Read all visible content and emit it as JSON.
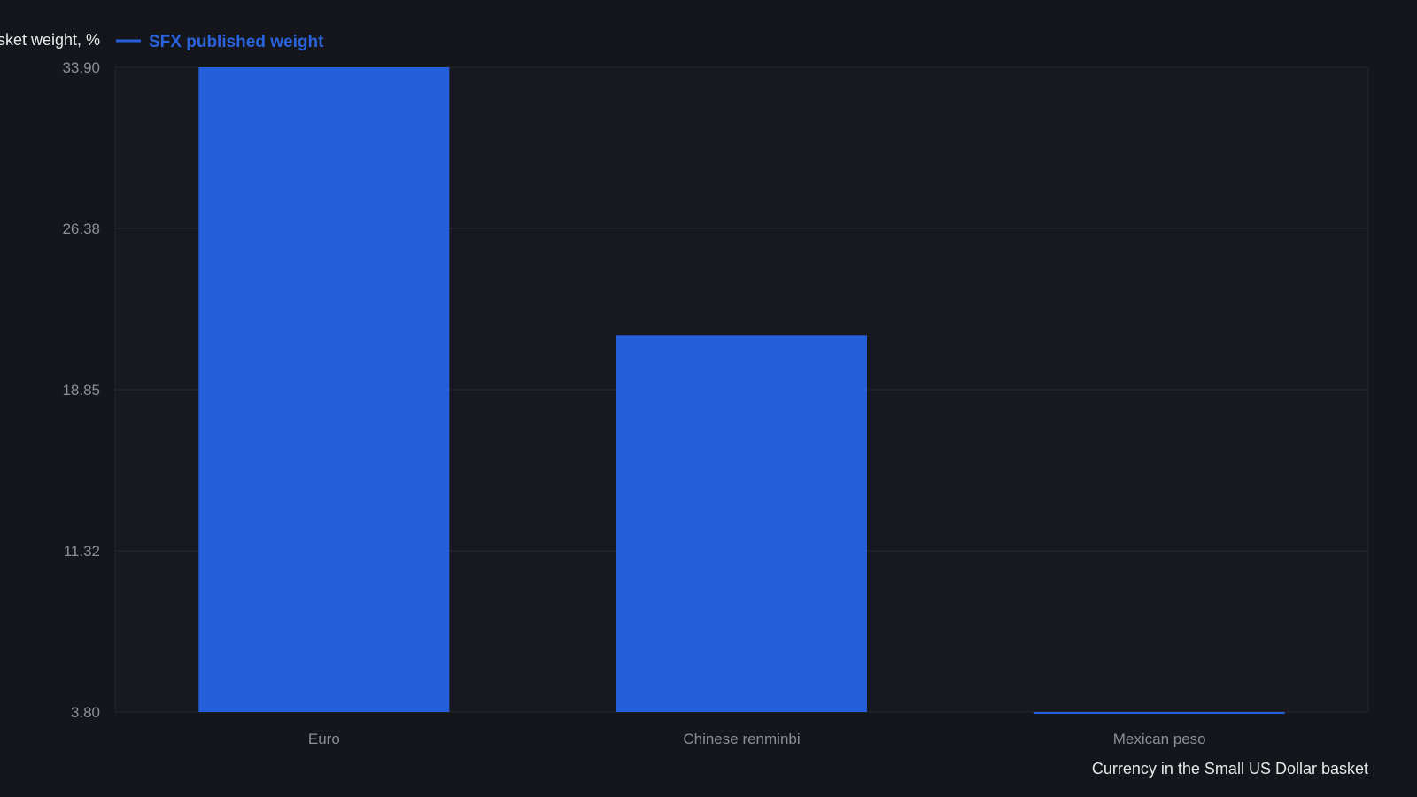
{
  "chart_data": {
    "type": "bar",
    "ylabel": "Basket weight, %",
    "xlabel": "Currency in the Small US Dollar basket",
    "legend": {
      "position": "top-left",
      "entries": [
        "SFX published weight"
      ]
    },
    "categories": [
      "Euro",
      "Chinese renminbi",
      "Mexican peso"
    ],
    "series": [
      {
        "name": "SFX published weight",
        "values": [
          33.9,
          21.4,
          3.7
        ]
      }
    ],
    "ylim": [
      3.8,
      33.9
    ],
    "yticks": [
      "3.80",
      "11.32",
      "18.85",
      "26.38",
      "33.90"
    ],
    "grid": true
  },
  "colors": {
    "background": "#14161b",
    "plot_background": "#17191e",
    "bar": "#2560dc",
    "legend_text": "#2b63dd",
    "grid": "#262a31",
    "tick_text": "#8a8f98",
    "axis_title": "#e6e8eb"
  }
}
